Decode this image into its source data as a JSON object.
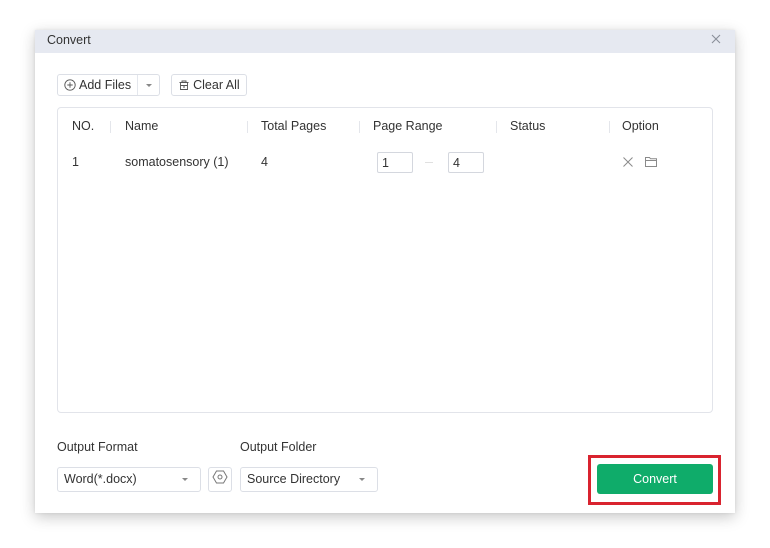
{
  "dialog": {
    "title": "Convert",
    "close_icon": "close-icon"
  },
  "toolbar": {
    "add_files_label": "Add Files",
    "add_files_icon": "plus-circle-icon",
    "clear_all_label": "Clear All",
    "clear_all_icon": "trash-icon"
  },
  "table": {
    "columns": [
      "NO.",
      "Name",
      "Total Pages",
      "Page Range",
      "Status",
      "Option"
    ],
    "rows": [
      {
        "no": "1",
        "name": "somatosensory (1)",
        "total_pages": "4",
        "range_from": "1",
        "range_to": "4",
        "status": "",
        "options": [
          "remove-icon",
          "folder-icon"
        ]
      }
    ]
  },
  "output": {
    "format_label": "Output Format",
    "format_value": "Word(*.docx)",
    "folder_label": "Output Folder",
    "folder_value": "Source Directory",
    "settings_icon": "settings-icon"
  },
  "actions": {
    "convert_label": "Convert",
    "convert_color": "#0fac6a",
    "highlight_color": "#d9232f"
  }
}
